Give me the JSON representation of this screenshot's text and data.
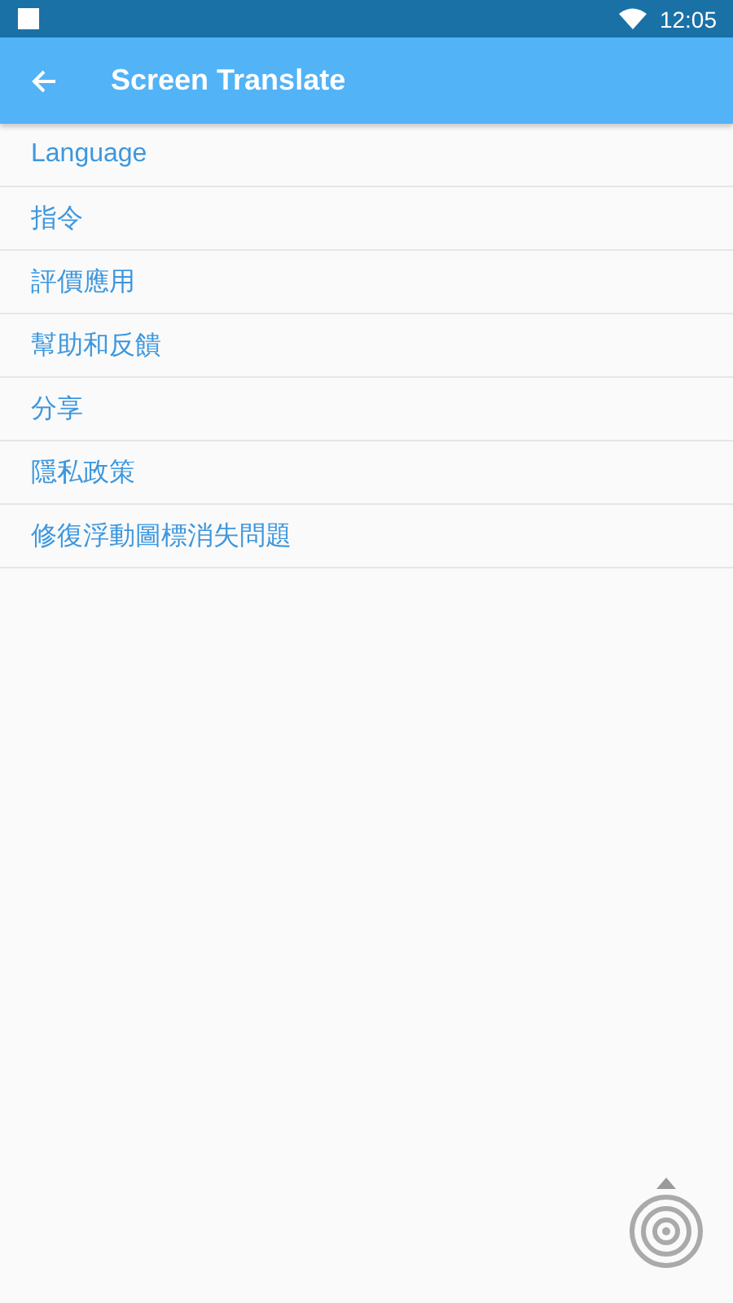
{
  "status_bar": {
    "time": "12:05"
  },
  "toolbar": {
    "title": "Screen Translate"
  },
  "menu": {
    "items": [
      {
        "label": "Language"
      },
      {
        "label": "指令"
      },
      {
        "label": "評價應用"
      },
      {
        "label": "幫助和反饋"
      },
      {
        "label": "分享"
      },
      {
        "label": "隱私政策"
      },
      {
        "label": "修復浮動圖標消失問題"
      }
    ]
  }
}
